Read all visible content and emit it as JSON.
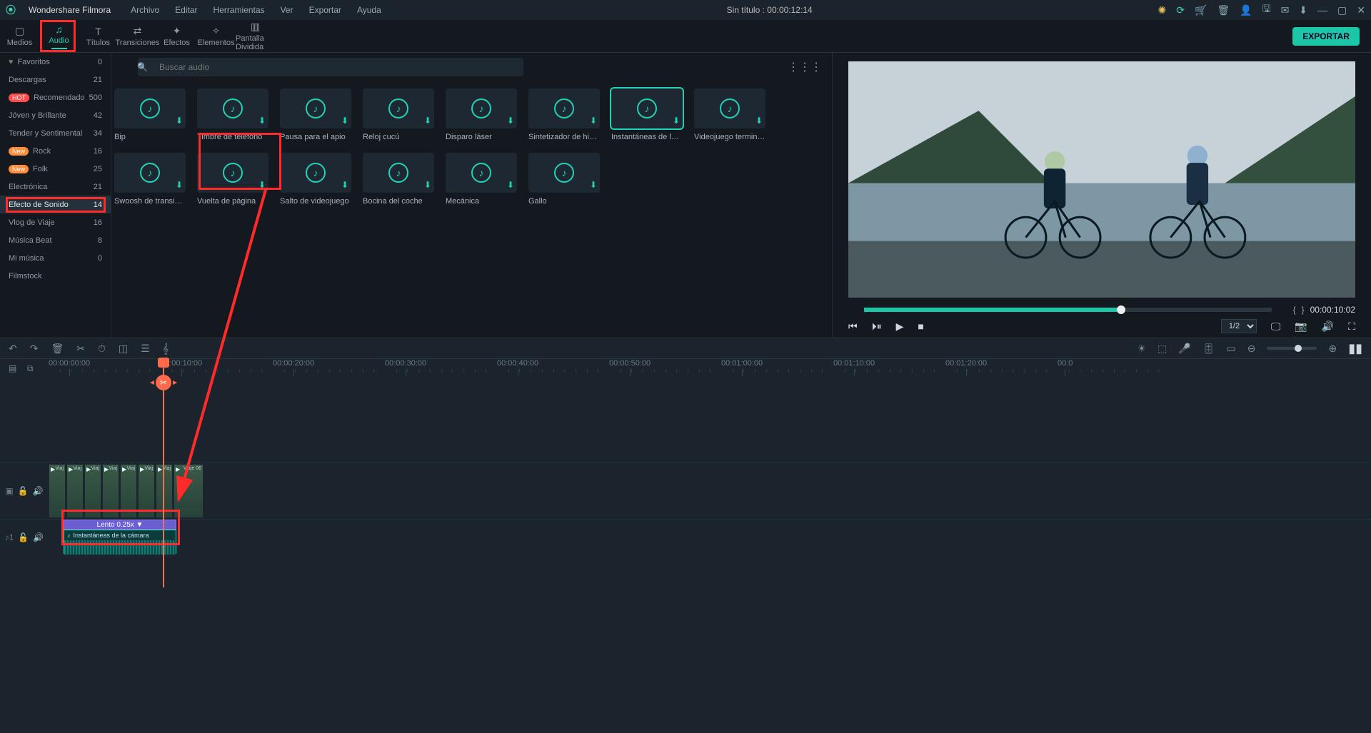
{
  "app": {
    "name": "Wondershare Filmora"
  },
  "menubar": {
    "items": [
      "Archivo",
      "Editar",
      "Herramientas",
      "Ver",
      "Exportar",
      "Ayuda"
    ]
  },
  "doc_title": "Sin título : 00:00:12:14",
  "tabs": [
    {
      "label": "Medios",
      "icon": "▢"
    },
    {
      "label": "Audio",
      "icon": "♫",
      "active": true
    },
    {
      "label": "Títulos",
      "icon": "T"
    },
    {
      "label": "Transiciones",
      "icon": "⇄"
    },
    {
      "label": "Efectos",
      "icon": "✦"
    },
    {
      "label": "Elementos",
      "icon": "✧"
    },
    {
      "label": "Pantalla Dividida",
      "icon": "▥"
    }
  ],
  "export_label": "EXPORTAR",
  "sidebar": [
    {
      "label": "Favoritos",
      "count": "0",
      "heart": true
    },
    {
      "label": "Descargas",
      "count": "21"
    },
    {
      "label": "Recomendado",
      "count": "500",
      "badge": "hot"
    },
    {
      "label": "Jóven y Brillante",
      "count": "42"
    },
    {
      "label": "Tender y Sentimental",
      "count": "34"
    },
    {
      "label": "Rock",
      "count": "16",
      "badge": "new"
    },
    {
      "label": "Folk",
      "count": "25",
      "badge": "new"
    },
    {
      "label": "Electrónica",
      "count": "21"
    },
    {
      "label": "Efecto de Sonido",
      "count": "14",
      "selected": true
    },
    {
      "label": "Vlog de Viaje",
      "count": "16"
    },
    {
      "label": "Música Beat",
      "count": "8"
    },
    {
      "label": "Mi música",
      "count": "0"
    },
    {
      "label": "Filmstock",
      "count": ""
    }
  ],
  "search": {
    "placeholder": "Buscar audio"
  },
  "grid": [
    {
      "label": "Bip"
    },
    {
      "label": "Timbre de teléfono"
    },
    {
      "label": "Pausa para el apio"
    },
    {
      "label": "Reloj cucú"
    },
    {
      "label": "Disparo láser"
    },
    {
      "label": "Sintetizador de histor…"
    },
    {
      "label": "Instantáneas de la cá…",
      "selected": true
    },
    {
      "label": "Videojuego terminado"
    },
    {
      "label": "Swoosh de transición"
    },
    {
      "label": "Vuelta de página"
    },
    {
      "label": "Salto de videojuego"
    },
    {
      "label": "Bocina del coche"
    },
    {
      "label": "Mecánica"
    },
    {
      "label": "Gallo"
    }
  ],
  "preview": {
    "time": "00:00:10:02",
    "ratio": "1/2"
  },
  "ruler": [
    "00:00:00:00",
    "00:00:10:00",
    "00:00:20:00",
    "00:00:30:00",
    "00:00:40:00",
    "00:00:50:00",
    "00:01:00:00",
    "00:01:10:00",
    "00:01:20:00",
    "00:0"
  ],
  "clips": [
    {
      "cap": "Viaj"
    },
    {
      "cap": "Viaj"
    },
    {
      "cap": "Viaj"
    },
    {
      "cap": "Viaj"
    },
    {
      "cap": "Viaj"
    },
    {
      "cap": "Viaj"
    },
    {
      "cap": "Viaj"
    },
    {
      "cap": "Viaje 06"
    }
  ],
  "speed_label": "Lento 0.25x ▼",
  "audio_clip_title": "Instantáneas de la cámara"
}
